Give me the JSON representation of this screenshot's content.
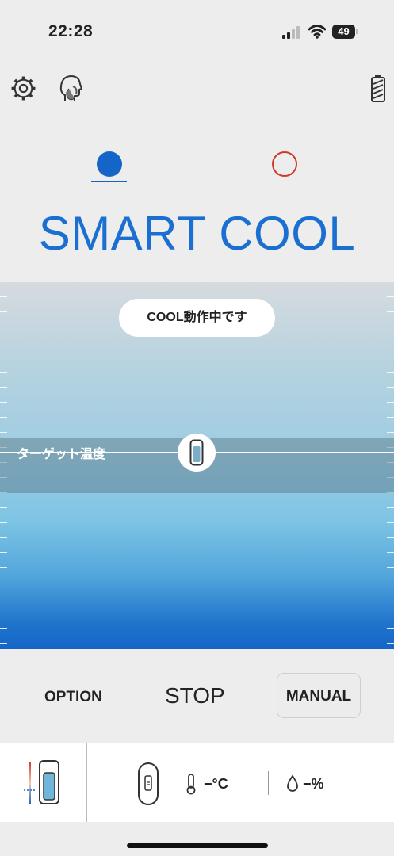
{
  "status_bar": {
    "time": "22:28",
    "battery_percent": "49"
  },
  "header": {
    "icons": [
      "gear-icon",
      "head-profile-icon",
      "battery-icon"
    ]
  },
  "mode_tabs": {
    "active_index": 0,
    "colors": {
      "active": "#1565c8",
      "inactive": "#d0392c"
    }
  },
  "title": "SMART COOL",
  "temperature_panel": {
    "status_text": "COOL動作中です",
    "target_label": "ターゲット温度"
  },
  "controls": {
    "option_label": "OPTION",
    "stop_label": "STOP",
    "manual_label": "MANUAL"
  },
  "readouts": {
    "temperature": "−°C",
    "humidity": "−%"
  },
  "colors": {
    "accent": "#1a6fd0",
    "panel_bottom": "#1565c8"
  }
}
